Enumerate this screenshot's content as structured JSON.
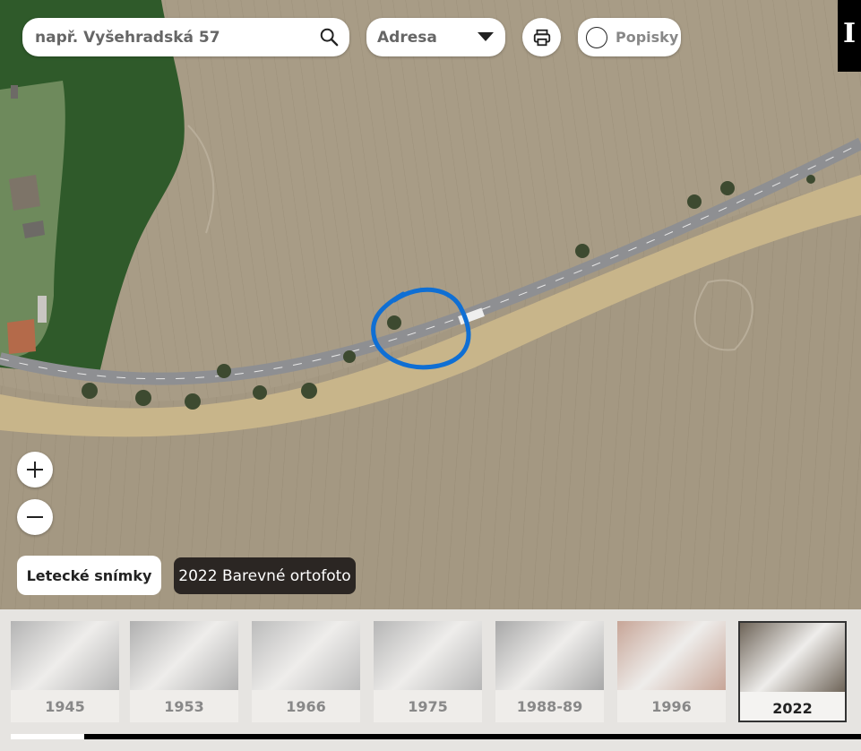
{
  "search": {
    "placeholder": "např. Vyšehradská 57"
  },
  "search_type": {
    "selected": "Adresa"
  },
  "labels_toggle": {
    "label": "Popisky"
  },
  "info_button": {
    "label": "I"
  },
  "layer_button": {
    "label": "Letecké snímky"
  },
  "layer_tooltip": {
    "label": "2022 Barevné ortofoto"
  },
  "years": [
    {
      "label": "1945"
    },
    {
      "label": "1953"
    },
    {
      "label": "1966"
    },
    {
      "label": "1975"
    },
    {
      "label": "1988-89"
    },
    {
      "label": "1996"
    },
    {
      "label": "2022"
    }
  ],
  "active_year_index": 6,
  "colors": {
    "annotation": "#0f6fd4",
    "field": "#a4977f",
    "road": "#8e8f92",
    "forest": "#2f5a2a"
  }
}
